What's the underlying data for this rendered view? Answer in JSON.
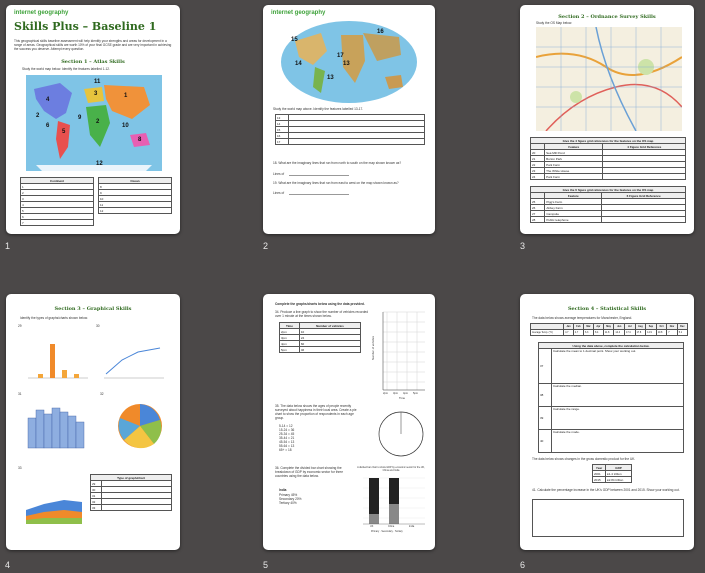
{
  "pages": [
    {
      "number": "1",
      "logo": "internet geography",
      "title": "Skills Plus – Baseline 1",
      "intro": "This geographical skills baseline assessment will help identify your strengths and areas for development in a range of areas. Geographical skills are worth 10% of your final GCSE grade and are very important in achieving the success you deserve. Attempt every question.",
      "section": "Section 1 – Atlas Skills",
      "prompt": "Study the world map below. Identify the features labelled 1-12.",
      "map_labels": [
        "1",
        "2",
        "3",
        "4",
        "5",
        "6",
        "7",
        "8",
        "9",
        "10",
        "11",
        "12"
      ],
      "col_continent": "Continent",
      "col_ocean": "Ocean",
      "left_rows": [
        "1",
        "2",
        "3",
        "4",
        "5",
        "6",
        "7"
      ],
      "right_rows": [
        "8",
        "9",
        "10",
        "11",
        "12"
      ]
    },
    {
      "number": "2",
      "logo": "internet geography",
      "map_labels": [
        "13",
        "14",
        "15",
        "16",
        "17"
      ],
      "prompt": "Study the world map above. Identify the features labelled 13-17.",
      "rows": [
        "13",
        "14",
        "15",
        "16",
        "17"
      ],
      "q18": "18. What are the imaginary lines that run from north to south on the map shown known as?",
      "q19": "19. What are the imaginary lines that run from east to west on the map shown known as?",
      "lines_of": "Lines of"
    },
    {
      "number": "3",
      "section": "Section 2 – Ordnance Survey Skills",
      "prompt": "Study the OS Map below.",
      "table1_head": "Give the 4 figure grid references for the features on the OS map",
      "cols": [
        "Feature",
        "4 Figure Grid Reference"
      ],
      "t1_rows": [
        [
          "20",
          "Sea Mill Pond"
        ],
        [
          "21",
          "Burton Park"
        ],
        [
          "22",
          "Park Farm"
        ],
        [
          "23",
          "The White House"
        ],
        [
          "24",
          "Park Farm"
        ]
      ],
      "table2_head": "Give the 6 figure grid references for the features on the OS map",
      "cols2": [
        "Feature",
        "6 Figure Grid Reference"
      ],
      "t2_rows": [
        [
          "25",
          "Pigg's Farm"
        ],
        [
          "26",
          "Abbey Farm"
        ],
        [
          "27",
          "Campsite"
        ],
        [
          "28",
          "Public telephone"
        ]
      ]
    },
    {
      "number": "4",
      "section": "Section 3 – Graphical Skills",
      "prompt": "Identify the types of graphs/charts shown below.",
      "labels": [
        "29",
        "30",
        "31",
        "32",
        "33"
      ],
      "table_head": "Type of graph/chart",
      "rows": [
        "29",
        "30",
        "31",
        "32",
        "33"
      ]
    },
    {
      "number": "5",
      "head": "Complete the graphs/charts below using the data provided.",
      "q34": "34. Produce a line graph to show the number of vehicles recorded over 1 minute at the times shown below.",
      "cols": [
        "Time",
        "Number of vehicles"
      ],
      "rows": [
        [
          "2pm",
          "10"
        ],
        [
          "3pm",
          "24"
        ],
        [
          "4pm",
          "60"
        ],
        [
          "5pm",
          "46"
        ]
      ],
      "ylabel": "Number of vehicles",
      "xlabel": "Time",
      "xticks": [
        "2pm",
        "3pm",
        "4pm",
        "5pm"
      ],
      "q35": "35. The data below shows the ages of people recently surveyed about happiness in their local area. Create a pie chart to show the proportion of respondents in each age group.",
      "ages": [
        "5-14 = 12",
        "15-24 = 36",
        "25-34 = 45",
        "35-44 = 21",
        "45-54 = 13",
        "55-64 = 13",
        "65+ = 18"
      ],
      "q36": "36. Complete the divided bar chart showing the breakdown of GDP by economic sector for three countries using the data below.",
      "india": "India",
      "sectors": [
        "Primary      45%",
        "Secondary   20%",
        "Tertiary      40%"
      ],
      "bars_title": "A divided bar chart to show GDP by economic sector for the UK, China and India",
      "bar_cats": [
        "UK",
        "China",
        "India"
      ],
      "legend": [
        "Primary",
        "Secondary",
        "Tertiary"
      ]
    },
    {
      "number": "6",
      "section": "Section 4 – Statistical Skills",
      "prompt": "The data below shows average temperatures for Manchester, England.",
      "months": [
        "Jan",
        "Feb",
        "Mar",
        "Apr",
        "May",
        "Jun",
        "Jul",
        "Aug",
        "Sep",
        "Oct",
        "Nov",
        "Dec"
      ],
      "temps": [
        "4.7",
        "4.7",
        "6.3",
        "8.4",
        "11.8",
        "14.4",
        "17.4",
        "17.8",
        "14.9",
        "10.8",
        "7",
        "5.1"
      ],
      "temp_label": "Average Temp. (°C)",
      "calc_head": "Using the data above, complete the calculation below.",
      "calc": [
        [
          "37",
          "Calculate the mean to 1 decimal point. Show your working out."
        ],
        [
          "38",
          "Calculate the median."
        ],
        [
          "39",
          "Calculate the range."
        ],
        [
          "40",
          "Calculate the mode."
        ]
      ],
      "gdp_intro": "The data below shows changes in the gross domestic product for the UK.",
      "gdp_cols": [
        "Year",
        "GDP"
      ],
      "gdp_rows": [
        [
          "2001",
          "£1.4 trillion"
        ],
        [
          "2015",
          "£2.84 trillion"
        ]
      ],
      "q41": "41. Calculate the percentage increase in the UK's GDP between 2001 and 2015. Show your working out."
    }
  ],
  "chart_data": {
    "type": "table",
    "categories": [
      "2pm",
      "3pm",
      "4pm",
      "5pm"
    ],
    "values": [
      10,
      24,
      60,
      46
    ]
  }
}
